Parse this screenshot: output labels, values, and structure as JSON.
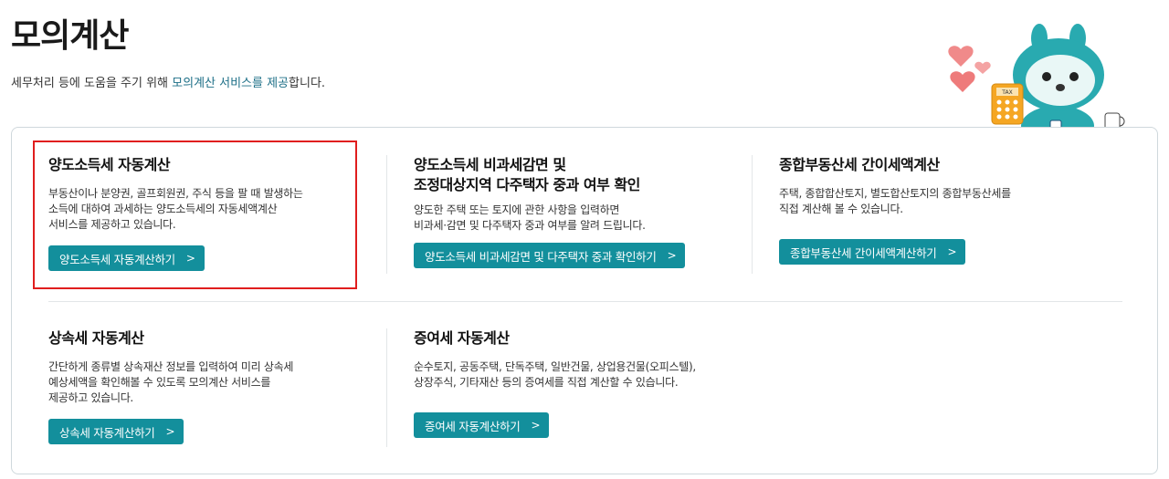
{
  "header": {
    "title": "모의계산",
    "desc_prefix": "세무처리 등에 도움을 주기 위해 ",
    "desc_highlight": "모의계산 서비스를 제공",
    "desc_suffix": "합니다."
  },
  "mascot": {
    "badge_text": "TAX"
  },
  "cards": [
    {
      "title": "양도소득세 자동계산",
      "desc": "부동산이나 분양권, 골프회원권, 주식 등을 팔 때 발생하는\n소득에 대하여 과세하는 양도소득세의 자동세액계산\n서비스를 제공하고 있습니다.",
      "button": "양도소득세 자동계산하기"
    },
    {
      "title": "양도소득세 비과세감면 및\n조정대상지역 다주택자 중과 여부 확인",
      "desc": "양도한 주택 또는 토지에 관한 사항을 입력하면\n비과세·감면 및 다주택자 중과 여부를 알려 드립니다.",
      "button": "양도소득세 비과세감면 및 다주택자 중과 확인하기"
    },
    {
      "title": "종합부동산세 간이세액계산",
      "desc": "주택, 종합합산토지, 별도합산토지의 종합부동산세를\n직접 계산해 볼 수 있습니다.",
      "button": "종합부동산세 간이세액계산하기"
    },
    {
      "title": "상속세 자동계산",
      "desc": "간단하게 종류별 상속재산 정보를 입력하여 미리 상속세\n예상세액을 확인해볼 수 있도록 모의계산 서비스를\n제공하고 있습니다.",
      "button": "상속세 자동계산하기"
    },
    {
      "title": "증여세 자동계산",
      "desc": "순수토지, 공동주택, 단독주택, 일반건물, 상업용건물(오피스텔),\n상장주식, 기타재산 등의 증여세를 직접 계산할 수 있습니다.",
      "button": "증여세 자동계산하기"
    }
  ],
  "colors": {
    "accent": "#138f9c",
    "highlight_border": "#e01e1e",
    "link": "#1d6f87"
  }
}
